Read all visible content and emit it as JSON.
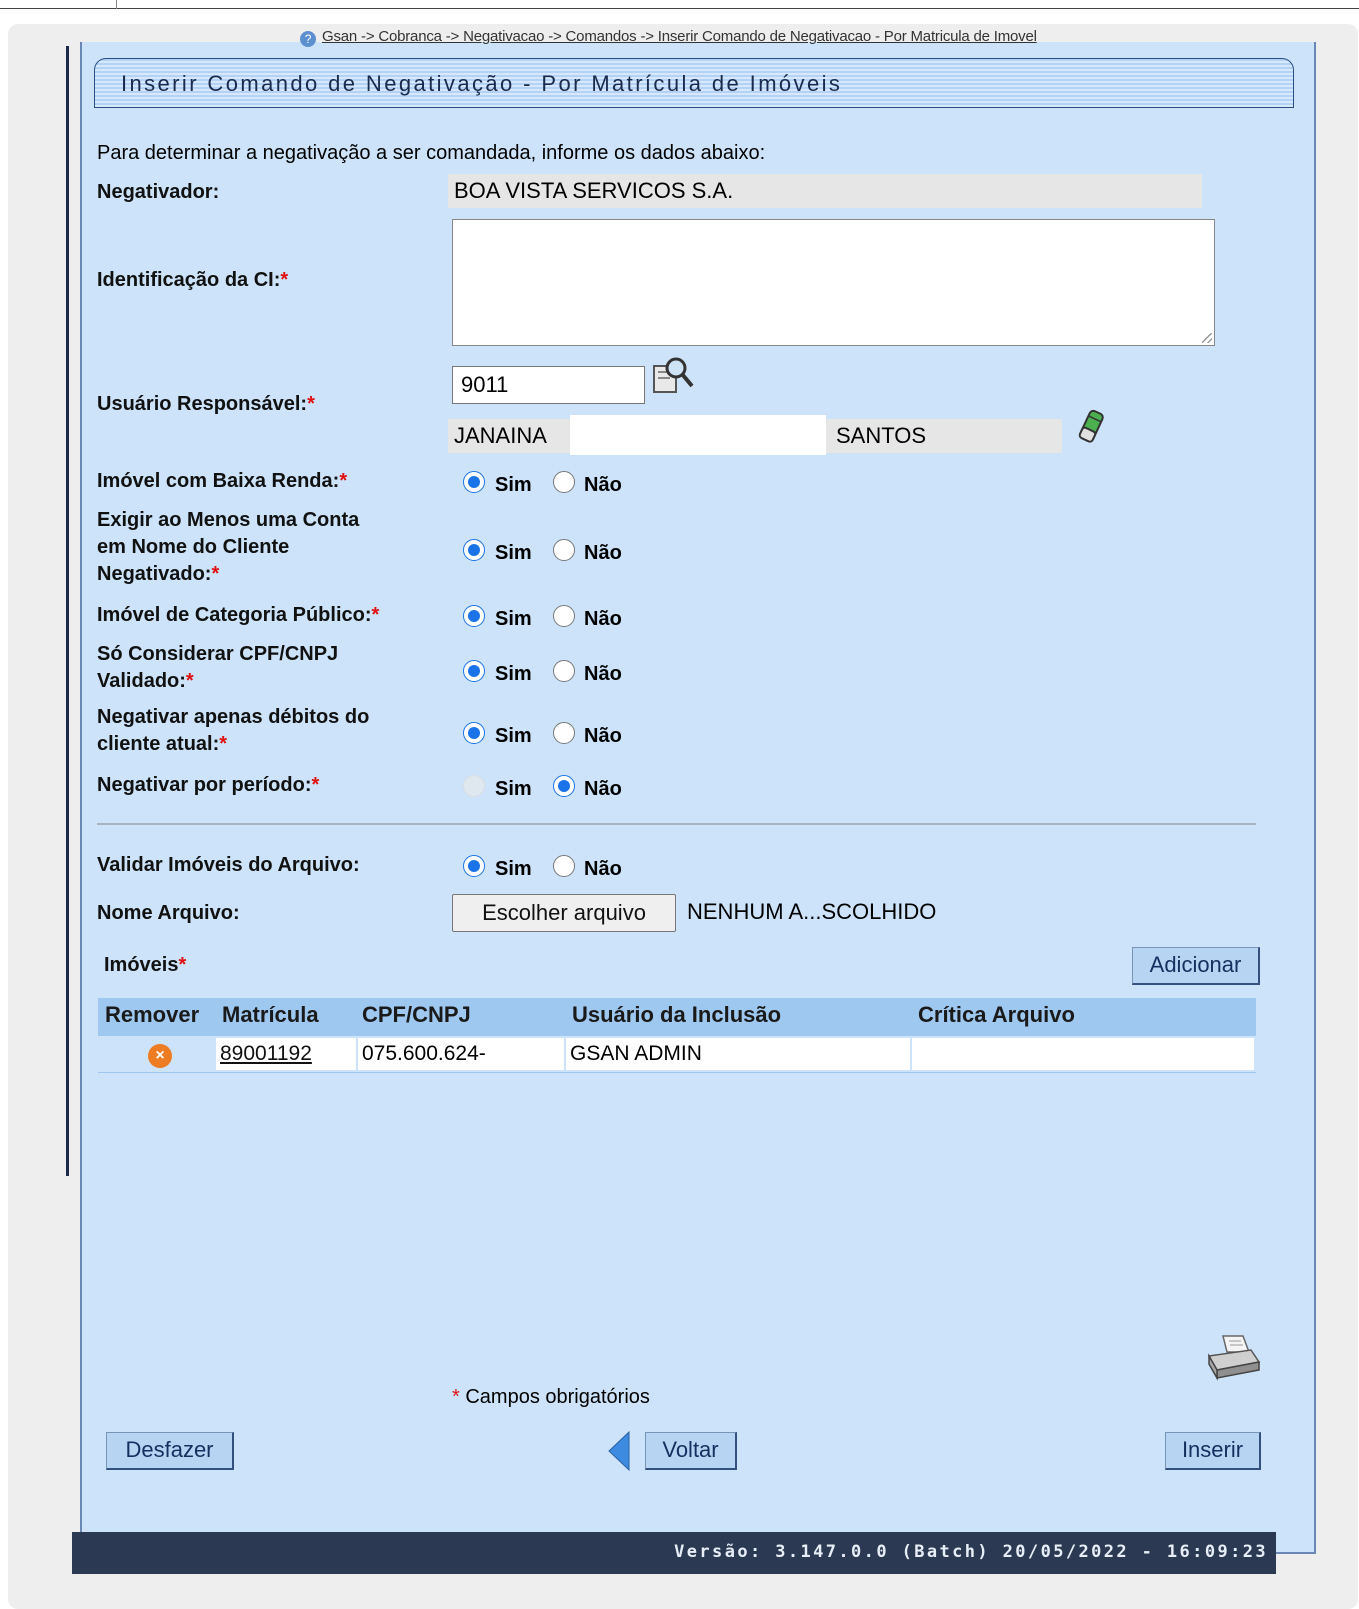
{
  "breadcrumb": "Gsan -> Cobranca -> Negativacao -> Comandos -> Inserir Comando de Negativacao - Por Matricula de Imovel",
  "breadcrumb_icon": "help-icon",
  "title": "Inserir Comando de Negativação - Por Matrícula de Imóveis",
  "intro": "Para determinar a negativação a ser comandada, informe os dados abaixo:",
  "required_mark": "*",
  "fields": {
    "negativador_label": "Negativador:",
    "negativador_value": "BOA VISTA SERVICOS S.A.",
    "identificacao_label": "Identificação da CI:",
    "identificacao_value": "",
    "usuario_label": "Usuário Responsável:",
    "usuario_code": "9011",
    "usuario_name_first": "JANAINA",
    "usuario_name_last": "SANTOS"
  },
  "radios": {
    "sim": "Sim",
    "nao": "Não",
    "baixa_renda": {
      "label": "Imóvel com Baixa Renda:",
      "selected": "Sim"
    },
    "exigir_conta_l1": "Exigir ao Menos uma Conta",
    "exigir_conta_l2": "em Nome do Cliente",
    "exigir_conta_l3": "Negativado:",
    "exigir_conta_selected": "Sim",
    "categoria_publico": {
      "label": "Imóvel de Categoria Público:",
      "selected": "Sim"
    },
    "cpf_validado_l1": "Só Considerar CPF/CNPJ",
    "cpf_validado_l2": "Validado:",
    "cpf_validado_selected": "Sim",
    "debitos_l1": "Negativar apenas débitos do",
    "debitos_l2": "cliente atual:",
    "debitos_selected": "Sim",
    "periodo": {
      "label": "Negativar por período:",
      "selected": "Não",
      "sim_disabled": true
    },
    "validar_arquivo": {
      "label": "Validar Imóveis do Arquivo:",
      "selected": "Sim"
    }
  },
  "arquivo": {
    "label": "Nome Arquivo:",
    "button": "Escolher arquivo",
    "status": "NENHUM A...SCOLHIDO"
  },
  "imoveis": {
    "label": "Imóveis",
    "add_button": "Adicionar",
    "columns": [
      "Remover",
      "Matrícula",
      "CPF/CNPJ",
      "Usuário da Inclusão",
      "Crítica Arquivo"
    ],
    "rows": [
      {
        "matricula": "89001192",
        "cpf": "075.600.624-",
        "usuario": "GSAN ADMIN",
        "critica": ""
      }
    ]
  },
  "icons": {
    "search": "search-icon",
    "eraser": "eraser-icon",
    "remove": "remove-icon",
    "printer": "printer-icon",
    "back_arrow": "back-arrow-icon"
  },
  "required_note": "Campos obrigatórios",
  "buttons": {
    "desfazer": "Desfazer",
    "voltar": "Voltar",
    "inserir": "Inserir"
  },
  "footer": "Versão: 3.147.0.0 (Batch) 20/05/2022 - 16:09:23",
  "colors": {
    "panel": "#cce3f9",
    "header_row": "#9fc8f1",
    "footer": "#2b3a52",
    "radio": "#1a73e8",
    "required": "#e01010"
  }
}
